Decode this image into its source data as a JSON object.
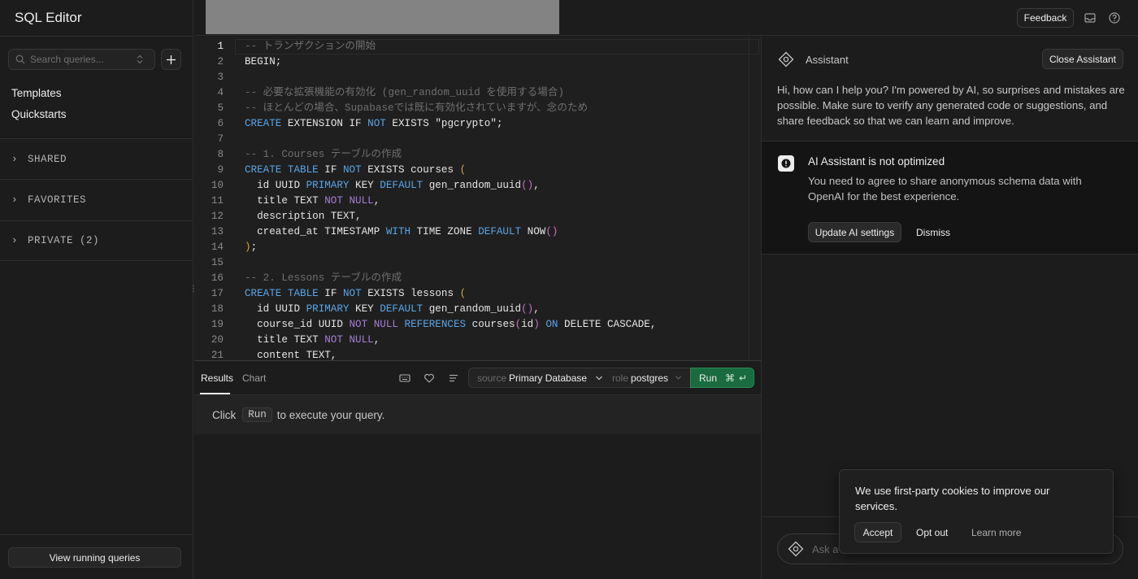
{
  "sidebar": {
    "title": "SQL Editor",
    "search_placeholder": "Search queries...",
    "links": [
      "Templates",
      "Quickstarts"
    ],
    "sections": [
      "SHARED",
      "FAVORITES",
      "PRIVATE (2)"
    ],
    "running_queries_label": "View running queries"
  },
  "topbar": {
    "feedback_label": "Feedback"
  },
  "editor": {
    "lines": [
      {
        "n": "1",
        "html": "<span class=\"c-com\">-- トランザクションの開始</span>"
      },
      {
        "n": "2",
        "html": "BEGIN;"
      },
      {
        "n": "3",
        "html": ""
      },
      {
        "n": "4",
        "html": "<span class=\"c-com\">-- 必要な拡張機能の有効化 (gen_random_uuid を使用する場合)</span>"
      },
      {
        "n": "5",
        "html": "<span class=\"c-com\">-- ほとんどの場合、Supabaseでは既に有効化されていますが、念のため</span>"
      },
      {
        "n": "6",
        "html": "<span class=\"c-kw\">CREATE</span> EXTENSION IF <span class=\"c-kw\">NOT</span> EXISTS <span class=\"c-str\">\"pgcrypto\"</span>;"
      },
      {
        "n": "7",
        "html": ""
      },
      {
        "n": "8",
        "html": "<span class=\"c-com\">-- 1. Courses テーブルの作成</span>"
      },
      {
        "n": "9",
        "html": "<span class=\"c-kw\">CREATE</span> <span class=\"c-kw\">TABLE</span> IF <span class=\"c-kw\">NOT</span> EXISTS courses <span class=\"c-par\">(</span>"
      },
      {
        "n": "10",
        "html": "  id UUID <span class=\"c-kw\">PRIMARY</span> KEY <span class=\"c-kw\">DEFAULT</span> gen_random_uuid<span class=\"c-fn\">()</span>,"
      },
      {
        "n": "11",
        "html": "  title TEXT <span class=\"c-nn\">NOT NULL</span>,"
      },
      {
        "n": "12",
        "html": "  description TEXT,"
      },
      {
        "n": "13",
        "html": "  created_at TIMESTAMP <span class=\"c-kw\">WITH</span> TIME ZONE <span class=\"c-kw\">DEFAULT</span> NOW<span class=\"c-fn\">()</span>"
      },
      {
        "n": "14",
        "html": "<span class=\"c-par\">)</span>;"
      },
      {
        "n": "15",
        "html": ""
      },
      {
        "n": "16",
        "html": "<span class=\"c-com\">-- 2. Lessons テーブルの作成</span>"
      },
      {
        "n": "17",
        "html": "<span class=\"c-kw\">CREATE</span> <span class=\"c-kw\">TABLE</span> IF <span class=\"c-kw\">NOT</span> EXISTS lessons <span class=\"c-par\">(</span>"
      },
      {
        "n": "18",
        "html": "  id UUID <span class=\"c-kw\">PRIMARY</span> KEY <span class=\"c-kw\">DEFAULT</span> gen_random_uuid<span class=\"c-fn\">()</span>,"
      },
      {
        "n": "19",
        "html": "  course_id UUID <span class=\"c-nn\">NOT NULL</span> <span class=\"c-kw\">REFERENCES</span> courses<span class=\"c-fn\">(</span>id<span class=\"c-fn\">)</span> <span class=\"c-kw\">ON</span> DELETE CASCADE,"
      },
      {
        "n": "20",
        "html": "  title TEXT <span class=\"c-nn\">NOT NULL</span>,"
      },
      {
        "n": "21",
        "html": "  content TEXT,"
      }
    ]
  },
  "results": {
    "tab_results": "Results",
    "tab_chart": "Chart",
    "source_label": "source",
    "source_value": "Primary Database",
    "role_label": "role",
    "role_value": "postgres",
    "run_label": "Run",
    "hint_before": "Click",
    "hint_key": "Run",
    "hint_after": "to execute your query."
  },
  "assistant": {
    "title": "Assistant",
    "close_label": "Close Assistant",
    "intro": "Hi, how can I help you? I'm powered by AI, so surprises and mistakes are possible. Make sure to verify any generated code or suggestions, and share feedback so that we can learn and improve.",
    "warning_title": "AI Assistant is not optimized",
    "warning_text": "You need to agree to share anonymous schema data with OpenAI for the best experience.",
    "update_label": "Update AI settings",
    "dismiss_label": "Dismiss",
    "input_placeholder": "Ask a"
  },
  "cookie": {
    "text": "We use first-party cookies to improve our services.",
    "accept": "Accept",
    "opt_out": "Opt out",
    "learn_more": "Learn more"
  },
  "colors": {
    "run_green": "#1a6b3f",
    "keyword_blue": "#5aa5e6",
    "comment_gray": "#6f6f6f"
  }
}
